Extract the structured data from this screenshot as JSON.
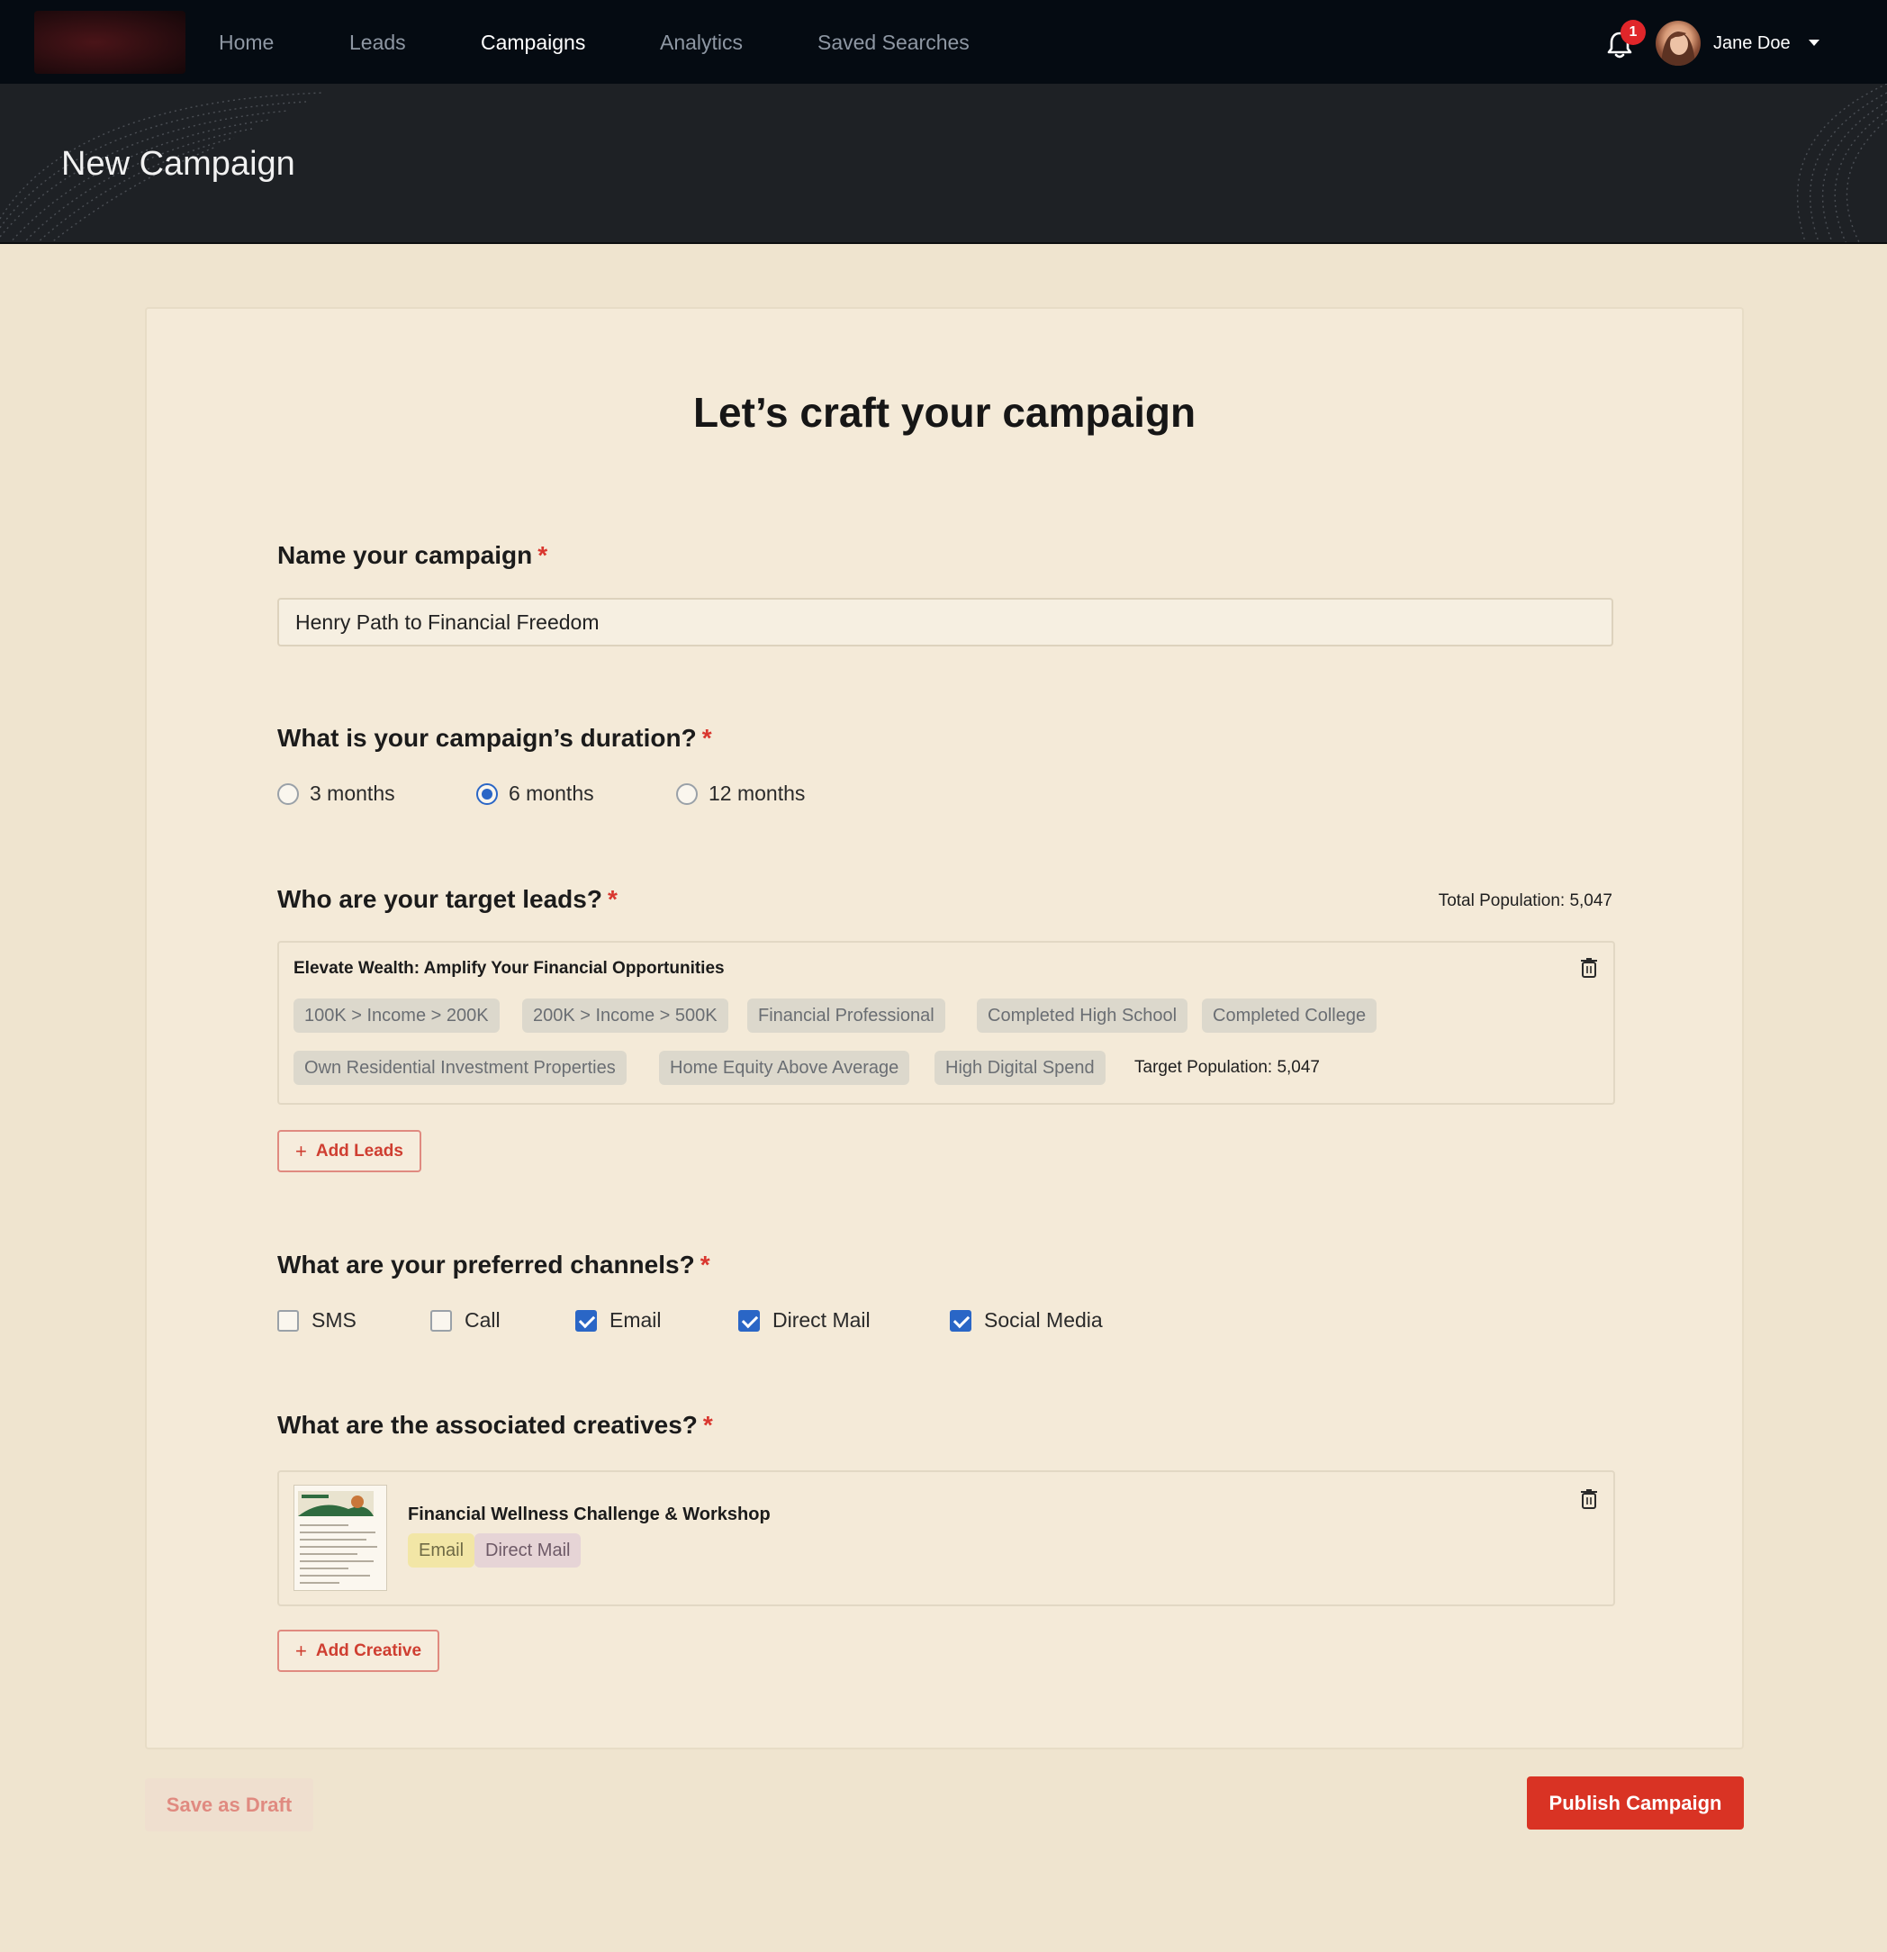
{
  "nav": {
    "items": [
      {
        "label": "Home"
      },
      {
        "label": "Leads"
      },
      {
        "label": "Campaigns"
      },
      {
        "label": "Analytics"
      },
      {
        "label": "Saved Searches"
      }
    ],
    "active": "Campaigns",
    "notification_count": "1",
    "user_name": "Jane Doe"
  },
  "header": {
    "page_title": "New Campaign"
  },
  "form": {
    "heading": "Let’s craft your campaign",
    "name": {
      "label": "Name your campaign",
      "required_mark": "*",
      "value": "Henry Path to Financial Freedom"
    },
    "duration": {
      "label": "What is your campaign’s duration?",
      "required_mark": "*",
      "options": [
        {
          "label": "3 months",
          "selected": false
        },
        {
          "label": "6 months",
          "selected": true
        },
        {
          "label": "12 months",
          "selected": false
        }
      ]
    },
    "leads": {
      "label": "Who are your target leads?",
      "required_mark": "*",
      "total_population": "Total Population: 5,047",
      "segment": {
        "title": "Elevate Wealth: Amplify Your Financial Opportunities",
        "tags": [
          "100K > Income > 200K",
          "200K > Income > 500K",
          "Financial Professional",
          "Completed High School",
          "Completed College",
          "Own Residential Investment Properties",
          "Home Equity Above Average",
          "High Digital Spend"
        ],
        "target_population": "Target Population: 5,047"
      },
      "add_button": "Add Leads"
    },
    "channels": {
      "label": "What are your preferred channels?",
      "required_mark": "*",
      "options": [
        {
          "label": "SMS",
          "checked": false
        },
        {
          "label": "Call",
          "checked": false
        },
        {
          "label": "Email",
          "checked": true
        },
        {
          "label": "Direct Mail",
          "checked": true
        },
        {
          "label": "Social Media",
          "checked": true
        }
      ]
    },
    "creatives": {
      "label": "What are the associated creatives?",
      "required_mark": "*",
      "item": {
        "title": "Financial Wellness Challenge & Workshop",
        "channels": [
          "Email",
          "Direct Mail"
        ]
      },
      "add_button": "Add Creative"
    }
  },
  "actions": {
    "save_draft": "Save as Draft",
    "publish": "Publish Campaign"
  },
  "colors": {
    "nav_bg": "#050b12",
    "page_bg": "#efe4cf",
    "accent_red": "#d93324",
    "checkbox_blue": "#2a66c6"
  },
  "icons": {
    "bell": "bell-icon",
    "caret": "chevron-down-icon",
    "trash": "trash-icon",
    "plus": "plus-icon"
  }
}
